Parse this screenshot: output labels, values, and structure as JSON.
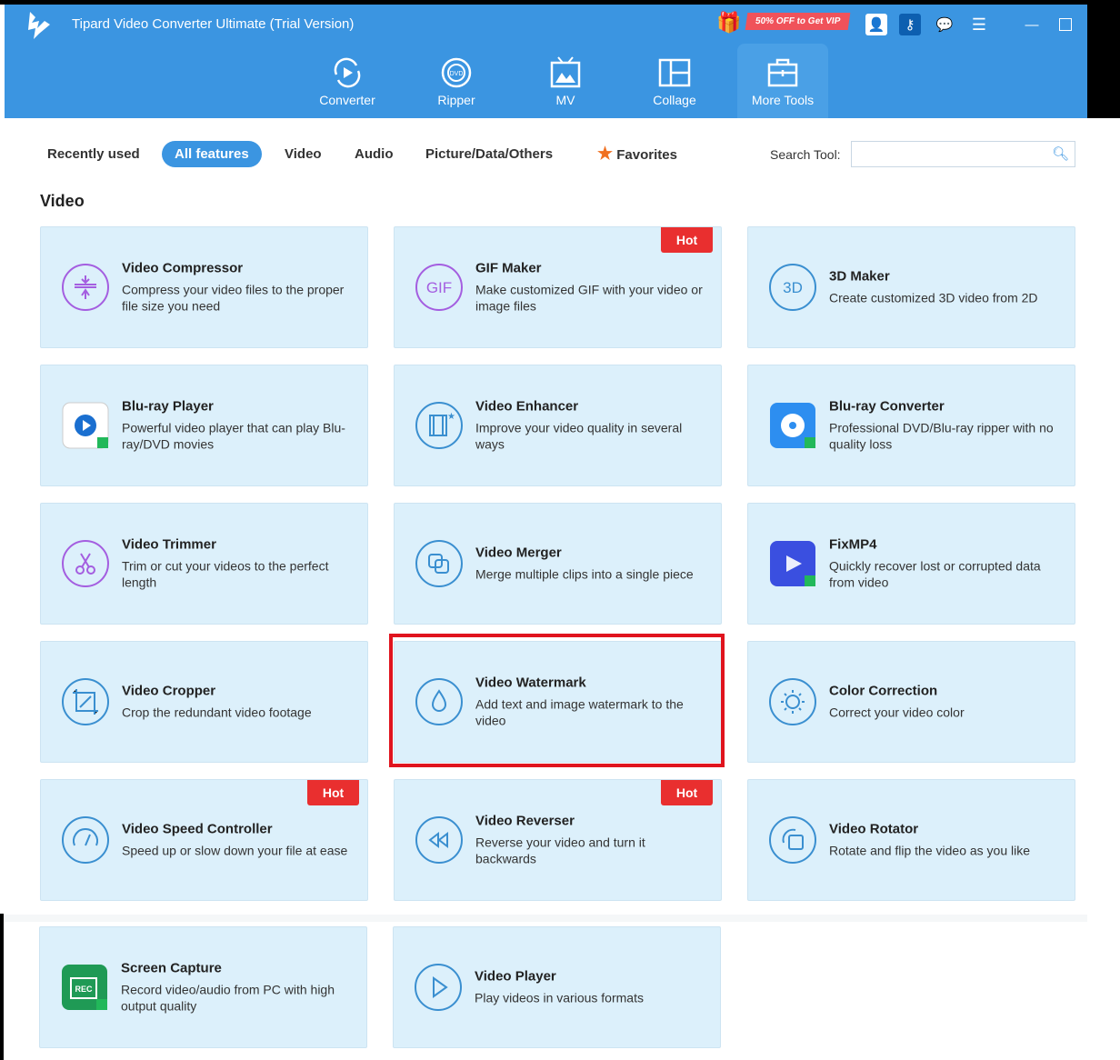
{
  "app": {
    "title": "Tipard Video Converter Ultimate (Trial Version)",
    "promo": "50% OFF to Get VIP"
  },
  "nav": [
    {
      "label": "Converter",
      "icon": "converter-icon"
    },
    {
      "label": "Ripper",
      "icon": "dvd-icon"
    },
    {
      "label": "MV",
      "icon": "tv-icon"
    },
    {
      "label": "Collage",
      "icon": "collage-icon"
    },
    {
      "label": "More Tools",
      "icon": "toolbox-icon",
      "active": true
    }
  ],
  "tabs": [
    {
      "label": "Recently used"
    },
    {
      "label": "All features",
      "active": true
    },
    {
      "label": "Video"
    },
    {
      "label": "Audio"
    },
    {
      "label": "Picture/Data/Others"
    },
    {
      "label": "Favorites",
      "icon": "star-icon"
    }
  ],
  "search": {
    "label": "Search Tool:",
    "value": ""
  },
  "section_title": "Video",
  "tools": [
    {
      "name": "Video Compressor",
      "desc": "Compress your video files to the proper file size you need",
      "icon": "compress-icon",
      "color": "#a45ee0"
    },
    {
      "name": "GIF Maker",
      "desc": "Make customized GIF with your video or image files",
      "icon": "gif-icon",
      "color": "#a45ee0",
      "badge": "Hot"
    },
    {
      "name": "3D Maker",
      "desc": "Create customized 3D video from 2D",
      "icon": "3d-icon",
      "color": "#3a8fd0"
    },
    {
      "name": "Blu-ray Player",
      "desc": "Powerful video player that can play Blu-ray/DVD movies",
      "icon": "bluray-player-icon",
      "color": "#1a6fd0"
    },
    {
      "name": "Video Enhancer",
      "desc": "Improve your video quality in several ways",
      "icon": "enhance-icon",
      "color": "#3a8fd0"
    },
    {
      "name": "Blu-ray Converter",
      "desc": "Professional DVD/Blu-ray ripper with no quality loss",
      "icon": "bluray-converter-icon",
      "color": "#2d8ef0"
    },
    {
      "name": "Video Trimmer",
      "desc": "Trim or cut your videos to the perfect length",
      "icon": "scissors-icon",
      "color": "#a45ee0"
    },
    {
      "name": "Video Merger",
      "desc": "Merge multiple clips into a single piece",
      "icon": "merge-icon",
      "color": "#3a8fd0"
    },
    {
      "name": "FixMP4",
      "desc": "Quickly recover lost or corrupted data from video",
      "icon": "fixmp4-icon",
      "color": "#3a4fe0"
    },
    {
      "name": "Video Cropper",
      "desc": "Crop the redundant video footage",
      "icon": "crop-icon",
      "color": "#3a8fd0"
    },
    {
      "name": "Video Watermark",
      "desc": "Add text and image watermark to the video",
      "icon": "watermark-icon",
      "color": "#3a8fd0"
    },
    {
      "name": "Color Correction",
      "desc": "Correct your video color",
      "icon": "color-icon",
      "color": "#3a8fd0"
    },
    {
      "name": "Video Speed Controller",
      "desc": "Speed up or slow down your file at ease",
      "icon": "speed-icon",
      "color": "#3a8fd0",
      "badge": "Hot"
    },
    {
      "name": "Video Reverser",
      "desc": "Reverse your video and turn it backwards",
      "icon": "rewind-icon",
      "color": "#3a8fd0",
      "badge": "Hot"
    },
    {
      "name": "Video Rotator",
      "desc": "Rotate and flip the video as you like",
      "icon": "rotate-icon",
      "color": "#3a8fd0"
    },
    {
      "name": "Screen Capture",
      "desc": "Record video/audio from PC with high output quality",
      "icon": "rec-icon",
      "color": "#1f9a55"
    },
    {
      "name": "Video Player",
      "desc": "Play videos in various formats",
      "icon": "play-icon",
      "color": "#3a8fd0"
    }
  ]
}
